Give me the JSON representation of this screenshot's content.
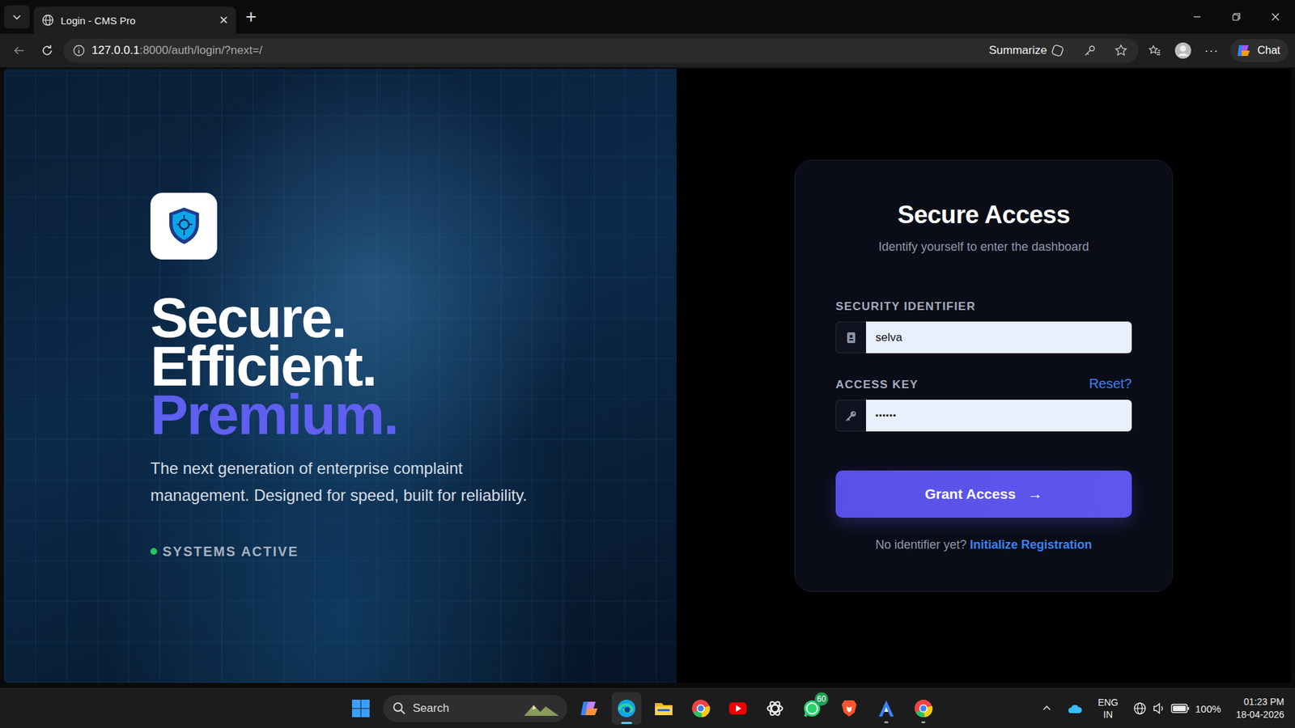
{
  "browser": {
    "tab": {
      "title": "Login - CMS Pro",
      "close": "×",
      "selected": true
    },
    "new_tab": "+",
    "url": {
      "host": "127.0.0.1",
      "rest": ":8000/auth/login/?next=/"
    },
    "toolbar": {
      "summarize": "Summarize",
      "more": "···",
      "chat": "Chat"
    }
  },
  "hero": {
    "lines": [
      {
        "text": "Secure.",
        "accent": false
      },
      {
        "text": "Efficient.",
        "accent": false
      },
      {
        "text": "Premium.",
        "accent": true
      }
    ],
    "description": "The next generation of enterprise complaint management. Designed for speed, built for reliability.",
    "status": {
      "label": "SYSTEMS ACTIVE",
      "on": true,
      "color": "#22c55e"
    }
  },
  "login": {
    "title": "Secure Access",
    "subtitle": "Identify yourself to enter the dashboard",
    "fields": [
      {
        "label": "SECURITY IDENTIFIER",
        "value": "selva",
        "kind": "text"
      },
      {
        "label": "ACCESS KEY",
        "value": "••••••",
        "kind": "password",
        "link": "Reset?"
      }
    ],
    "submit": {
      "label": "Grant Access",
      "arrow": "→"
    },
    "footer": {
      "prompt": "No identifier yet?",
      "link": "Initialize Registration"
    }
  },
  "taskbar": {
    "search": "Search",
    "apps": [
      {
        "kind": "copilot",
        "selected": false,
        "running": false
      },
      {
        "kind": "edge",
        "selected": true,
        "running": true
      },
      {
        "kind": "folder",
        "selected": false,
        "running": false
      },
      {
        "kind": "chrome",
        "selected": false,
        "running": false
      },
      {
        "kind": "youtube",
        "selected": false,
        "running": false
      },
      {
        "kind": "chatgpt",
        "selected": false,
        "running": false
      },
      {
        "kind": "whatsapp",
        "selected": false,
        "running": false,
        "badge": "60"
      },
      {
        "kind": "brave",
        "selected": false,
        "running": false
      },
      {
        "kind": "triangle",
        "selected": false,
        "running": true
      },
      {
        "kind": "chrome",
        "selected": false,
        "running": true
      }
    ],
    "tray": {
      "language": "ENG",
      "region": "IN",
      "battery": "100%",
      "time": "01:23 PM",
      "date": "18-04-2026"
    }
  }
}
